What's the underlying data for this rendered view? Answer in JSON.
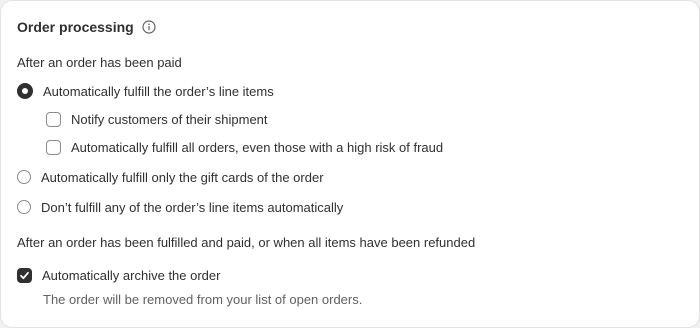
{
  "card": {
    "title": "Order processing",
    "info_icon": "info-circle-icon"
  },
  "paid_section": {
    "label": "After an order has been paid",
    "options": [
      {
        "label": "Automatically fulfill the order’s line items",
        "selected": true
      },
      {
        "label": "Automatically fulfill only the gift cards of the order",
        "selected": false
      },
      {
        "label": "Don’t fulfill any of the order’s line items automatically",
        "selected": false
      }
    ],
    "sub_options": [
      {
        "label": "Notify customers of their shipment",
        "checked": false
      },
      {
        "label": "Automatically fulfill all orders, even those with a high risk of fraud",
        "checked": false
      }
    ]
  },
  "fulfilled_section": {
    "label": "After an order has been fulfilled and paid, or when all items have been refunded",
    "archive": {
      "label": "Automatically archive the order",
      "checked": true,
      "help_text": "The order will be removed from your list of open orders."
    }
  },
  "colors": {
    "text": "#303030",
    "muted": "#616161",
    "border": "#8a8a8a",
    "checked": "#303030"
  }
}
